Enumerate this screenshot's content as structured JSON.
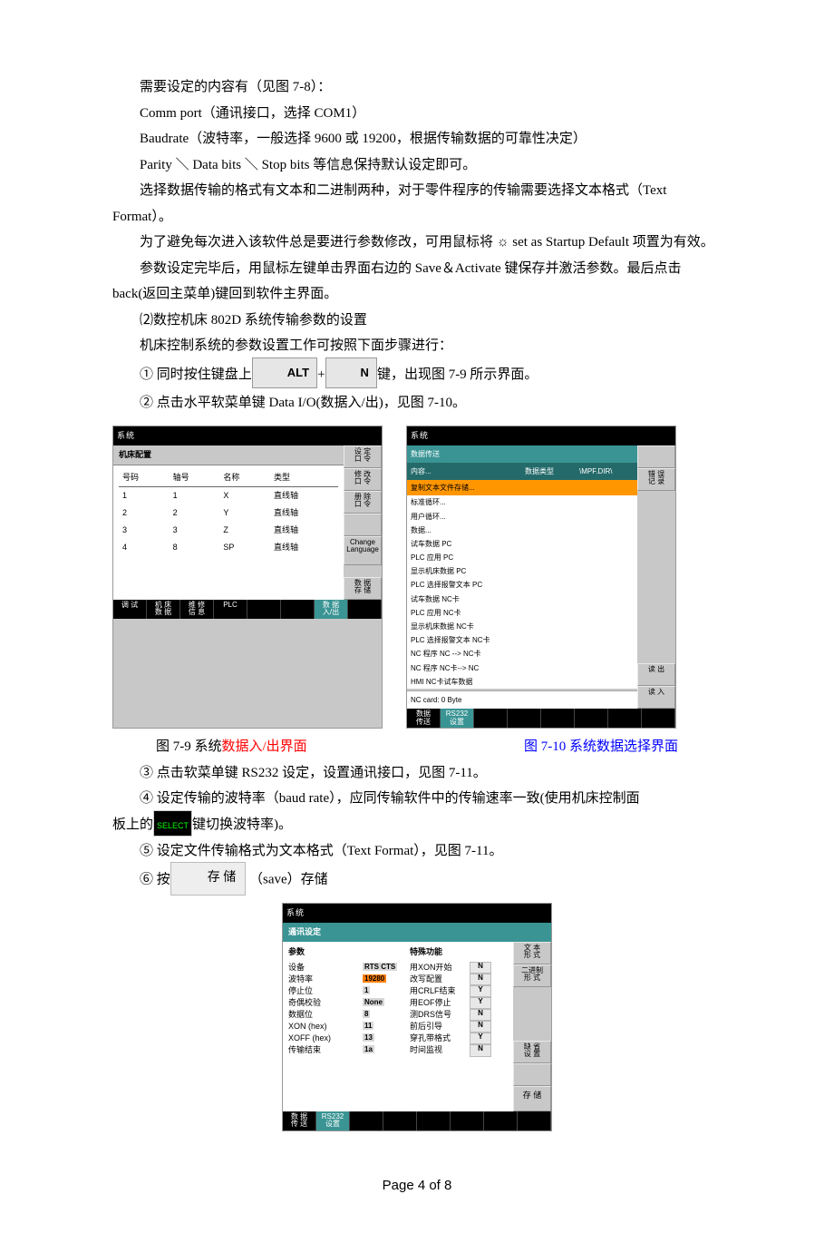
{
  "body": {
    "p1": "需要设定的内容有（见图 7-8）：",
    "p2": "Comm port（通讯接口，选择 COM1）",
    "p3": "Baudrate（波特率，一般选择 9600 或 19200，根据传输数据的可靠性决定）",
    "p4": "Parity ＼ Data bits ＼ Stop bits 等信息保持默认设定即可。",
    "p5": "选择数据传输的格式有文本和二进制两种，对于零件程序的传输需要选择文本格式（Text Format）。",
    "p6a": "为了避免每次进入该软件总是要进行参数修改，可用鼠标将 ",
    "sun": "☼",
    "p6b": " set as Startup Default 项置为有效。",
    "p7": "参数设定完毕后，用鼠标左键单击界面右边的 Save＆Activate 键保存并激活参数。最后点击 back(返回主菜单)键回到软件主界面。",
    "p8": "⑵数控机床 802D 系统传输参数的设置",
    "p9": "机床控制系统的参数设置工作可按照下面步骤进行：",
    "step1a": "① 同时按住键盘上",
    "keyAlt": "ALT",
    "plus": "+",
    "keyN": "N",
    "step1b": "键，出现图 7-9 所示界面。",
    "step2": "② 点击水平软菜单键 Data I/O(数据入/出)，见图 7-10。",
    "cap79a": "图 7-9  系统",
    "cap79b": "数据入/出界面",
    "cap710": "图 7-10   系统数据选择界面",
    "step3": "③ 点击软菜单键 RS232 设定，设置通讯接口，见图 7-11。",
    "step4": "④ 设定传输的波特率（baud rate），应同传输软件中的传输速率一致(使用机床控制面",
    "step4b_a": "板上的",
    "selectLabel": "SELECT",
    "step4b_b": "键切换波特率)。",
    "step5": "⑤ 设定文件传输格式为文本格式（Text Format），见图 7-11。",
    "step6a": "⑥ 按",
    "saveBtn": "存 储",
    "step6b": " （save）存储"
  },
  "fig79": {
    "topbar": "系统",
    "sublabel": "机床配置",
    "side": [
      "修 改\n口 令",
      "修 改\n口 令",
      "册 除\n口 令",
      "",
      "Change\nLanguage",
      "",
      "数 据\n存 储"
    ],
    "sideA": "设 定\n口 令",
    "thead": [
      "号码",
      "轴号",
      "名称",
      "类型"
    ],
    "rows": [
      [
        "1",
        "1",
        "X",
        "直线轴"
      ],
      [
        "2",
        "2",
        "Y",
        "直线轴"
      ],
      [
        "3",
        "3",
        "Z",
        "直线轴"
      ],
      [
        "4",
        "8",
        "SP",
        "直线轴"
      ]
    ],
    "bottom": [
      "调 试",
      "机 床\n数 据",
      "维 修\n信 息",
      "PLC",
      "",
      "",
      "数 据\n入/出",
      ""
    ]
  },
  "fig710": {
    "topbar": "系统",
    "tab": "数据传送",
    "hdr1": "内容...",
    "hdr2": "数据类型",
    "hdr3": "\\MPF.DIR\\",
    "selected": "复制文本文件存储...",
    "items": [
      "标准循环...",
      "用户循环...",
      "数据...",
      "试车数据 PC",
      "PLC 应用 PC",
      "显示机床数据 PC",
      "PLC 选择报警文本 PC",
      "试车数据 NC卡",
      "PLC 应用 NC卡",
      "显示机床数据 NC卡",
      "PLC 选择报警文本 NC卡",
      "NC 程序 NC --> NC卡",
      "NC 程序 NC卡--> NC",
      "HMI NC卡试车数据"
    ],
    "card": "NC card: 0 Byte",
    "side": [
      "",
      "错 误\n记 录",
      "",
      "",
      "",
      "读 出",
      "读 入"
    ],
    "bottom": [
      "数据\n传送",
      "RS232\n设置",
      "",
      "",
      "",
      "",
      "",
      ""
    ]
  },
  "fig711": {
    "topbar": "系统",
    "tab": "通讯设定",
    "h1": "参数",
    "h2": "特殊功能",
    "rows": [
      [
        "设备",
        "RTS CTS",
        "用XON开始",
        "N"
      ],
      [
        "波特率",
        "19280",
        "改写配置",
        "N"
      ],
      [
        "停止位",
        "1",
        "用CRLF结束",
        "Y"
      ],
      [
        "奇偶校验",
        "None",
        "用EOF停止",
        "Y"
      ],
      [
        "数据位",
        "8",
        "测DRS信号",
        "N"
      ],
      [
        "XON (hex)",
        "11",
        "前后引导",
        "N"
      ],
      [
        "XOFF (hex)",
        "13",
        "穿孔带格式",
        "Y"
      ],
      [
        "传输结束",
        "1a",
        "时间监视",
        "N"
      ]
    ],
    "side": [
      "文 本\n形 式",
      "二进制\n形 式",
      "",
      "",
      "缺 省\n设 置",
      "",
      "存 储"
    ],
    "bottom": [
      "数 据\n传 送",
      "RS232\n设置",
      "",
      "",
      "",
      "",
      "",
      ""
    ]
  },
  "footer": "Page 4 of 8"
}
